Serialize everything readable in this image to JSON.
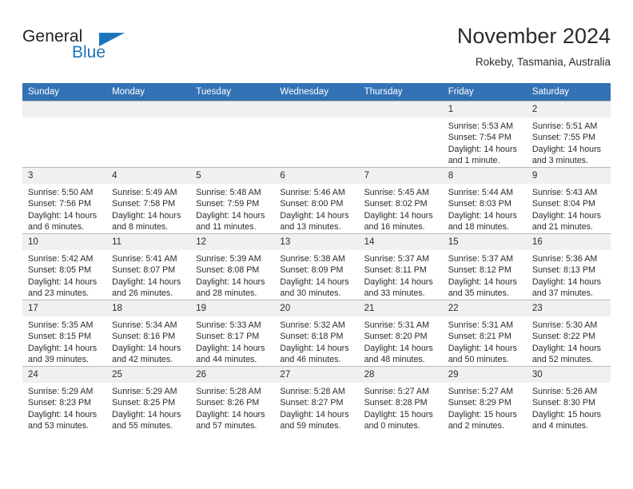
{
  "brand": {
    "name_part1": "General",
    "name_part2": "Blue",
    "triangle_color": "#1b75bc"
  },
  "header": {
    "title": "November 2024",
    "subtitle": "Rokeby, Tasmania, Australia"
  },
  "theme": {
    "header_bg": "#3372b5",
    "header_text": "#ffffff",
    "daynum_bg": "#f0f0f0",
    "grid_line": "#b9b9b9",
    "body_text": "#2b2b2b"
  },
  "calendar": {
    "weekday_headers": [
      "Sunday",
      "Monday",
      "Tuesday",
      "Wednesday",
      "Thursday",
      "Friday",
      "Saturday"
    ],
    "weeks": [
      [
        {
          "day": "",
          "sunrise": "",
          "sunset": "",
          "daylight": "",
          "empty": true
        },
        {
          "day": "",
          "sunrise": "",
          "sunset": "",
          "daylight": "",
          "empty": true
        },
        {
          "day": "",
          "sunrise": "",
          "sunset": "",
          "daylight": "",
          "empty": true
        },
        {
          "day": "",
          "sunrise": "",
          "sunset": "",
          "daylight": "",
          "empty": true
        },
        {
          "day": "",
          "sunrise": "",
          "sunset": "",
          "daylight": "",
          "empty": true
        },
        {
          "day": "1",
          "sunrise": "Sunrise: 5:53 AM",
          "sunset": "Sunset: 7:54 PM",
          "daylight": "Daylight: 14 hours and 1 minute.",
          "empty": false
        },
        {
          "day": "2",
          "sunrise": "Sunrise: 5:51 AM",
          "sunset": "Sunset: 7:55 PM",
          "daylight": "Daylight: 14 hours and 3 minutes.",
          "empty": false
        }
      ],
      [
        {
          "day": "3",
          "sunrise": "Sunrise: 5:50 AM",
          "sunset": "Sunset: 7:56 PM",
          "daylight": "Daylight: 14 hours and 6 minutes.",
          "empty": false
        },
        {
          "day": "4",
          "sunrise": "Sunrise: 5:49 AM",
          "sunset": "Sunset: 7:58 PM",
          "daylight": "Daylight: 14 hours and 8 minutes.",
          "empty": false
        },
        {
          "day": "5",
          "sunrise": "Sunrise: 5:48 AM",
          "sunset": "Sunset: 7:59 PM",
          "daylight": "Daylight: 14 hours and 11 minutes.",
          "empty": false
        },
        {
          "day": "6",
          "sunrise": "Sunrise: 5:46 AM",
          "sunset": "Sunset: 8:00 PM",
          "daylight": "Daylight: 14 hours and 13 minutes.",
          "empty": false
        },
        {
          "day": "7",
          "sunrise": "Sunrise: 5:45 AM",
          "sunset": "Sunset: 8:02 PM",
          "daylight": "Daylight: 14 hours and 16 minutes.",
          "empty": false
        },
        {
          "day": "8",
          "sunrise": "Sunrise: 5:44 AM",
          "sunset": "Sunset: 8:03 PM",
          "daylight": "Daylight: 14 hours and 18 minutes.",
          "empty": false
        },
        {
          "day": "9",
          "sunrise": "Sunrise: 5:43 AM",
          "sunset": "Sunset: 8:04 PM",
          "daylight": "Daylight: 14 hours and 21 minutes.",
          "empty": false
        }
      ],
      [
        {
          "day": "10",
          "sunrise": "Sunrise: 5:42 AM",
          "sunset": "Sunset: 8:05 PM",
          "daylight": "Daylight: 14 hours and 23 minutes.",
          "empty": false
        },
        {
          "day": "11",
          "sunrise": "Sunrise: 5:41 AM",
          "sunset": "Sunset: 8:07 PM",
          "daylight": "Daylight: 14 hours and 26 minutes.",
          "empty": false
        },
        {
          "day": "12",
          "sunrise": "Sunrise: 5:39 AM",
          "sunset": "Sunset: 8:08 PM",
          "daylight": "Daylight: 14 hours and 28 minutes.",
          "empty": false
        },
        {
          "day": "13",
          "sunrise": "Sunrise: 5:38 AM",
          "sunset": "Sunset: 8:09 PM",
          "daylight": "Daylight: 14 hours and 30 minutes.",
          "empty": false
        },
        {
          "day": "14",
          "sunrise": "Sunrise: 5:37 AM",
          "sunset": "Sunset: 8:11 PM",
          "daylight": "Daylight: 14 hours and 33 minutes.",
          "empty": false
        },
        {
          "day": "15",
          "sunrise": "Sunrise: 5:37 AM",
          "sunset": "Sunset: 8:12 PM",
          "daylight": "Daylight: 14 hours and 35 minutes.",
          "empty": false
        },
        {
          "day": "16",
          "sunrise": "Sunrise: 5:36 AM",
          "sunset": "Sunset: 8:13 PM",
          "daylight": "Daylight: 14 hours and 37 minutes.",
          "empty": false
        }
      ],
      [
        {
          "day": "17",
          "sunrise": "Sunrise: 5:35 AM",
          "sunset": "Sunset: 8:15 PM",
          "daylight": "Daylight: 14 hours and 39 minutes.",
          "empty": false
        },
        {
          "day": "18",
          "sunrise": "Sunrise: 5:34 AM",
          "sunset": "Sunset: 8:16 PM",
          "daylight": "Daylight: 14 hours and 42 minutes.",
          "empty": false
        },
        {
          "day": "19",
          "sunrise": "Sunrise: 5:33 AM",
          "sunset": "Sunset: 8:17 PM",
          "daylight": "Daylight: 14 hours and 44 minutes.",
          "empty": false
        },
        {
          "day": "20",
          "sunrise": "Sunrise: 5:32 AM",
          "sunset": "Sunset: 8:18 PM",
          "daylight": "Daylight: 14 hours and 46 minutes.",
          "empty": false
        },
        {
          "day": "21",
          "sunrise": "Sunrise: 5:31 AM",
          "sunset": "Sunset: 8:20 PM",
          "daylight": "Daylight: 14 hours and 48 minutes.",
          "empty": false
        },
        {
          "day": "22",
          "sunrise": "Sunrise: 5:31 AM",
          "sunset": "Sunset: 8:21 PM",
          "daylight": "Daylight: 14 hours and 50 minutes.",
          "empty": false
        },
        {
          "day": "23",
          "sunrise": "Sunrise: 5:30 AM",
          "sunset": "Sunset: 8:22 PM",
          "daylight": "Daylight: 14 hours and 52 minutes.",
          "empty": false
        }
      ],
      [
        {
          "day": "24",
          "sunrise": "Sunrise: 5:29 AM",
          "sunset": "Sunset: 8:23 PM",
          "daylight": "Daylight: 14 hours and 53 minutes.",
          "empty": false
        },
        {
          "day": "25",
          "sunrise": "Sunrise: 5:29 AM",
          "sunset": "Sunset: 8:25 PM",
          "daylight": "Daylight: 14 hours and 55 minutes.",
          "empty": false
        },
        {
          "day": "26",
          "sunrise": "Sunrise: 5:28 AM",
          "sunset": "Sunset: 8:26 PM",
          "daylight": "Daylight: 14 hours and 57 minutes.",
          "empty": false
        },
        {
          "day": "27",
          "sunrise": "Sunrise: 5:28 AM",
          "sunset": "Sunset: 8:27 PM",
          "daylight": "Daylight: 14 hours and 59 minutes.",
          "empty": false
        },
        {
          "day": "28",
          "sunrise": "Sunrise: 5:27 AM",
          "sunset": "Sunset: 8:28 PM",
          "daylight": "Daylight: 15 hours and 0 minutes.",
          "empty": false
        },
        {
          "day": "29",
          "sunrise": "Sunrise: 5:27 AM",
          "sunset": "Sunset: 8:29 PM",
          "daylight": "Daylight: 15 hours and 2 minutes.",
          "empty": false
        },
        {
          "day": "30",
          "sunrise": "Sunrise: 5:26 AM",
          "sunset": "Sunset: 8:30 PM",
          "daylight": "Daylight: 15 hours and 4 minutes.",
          "empty": false
        }
      ]
    ]
  }
}
